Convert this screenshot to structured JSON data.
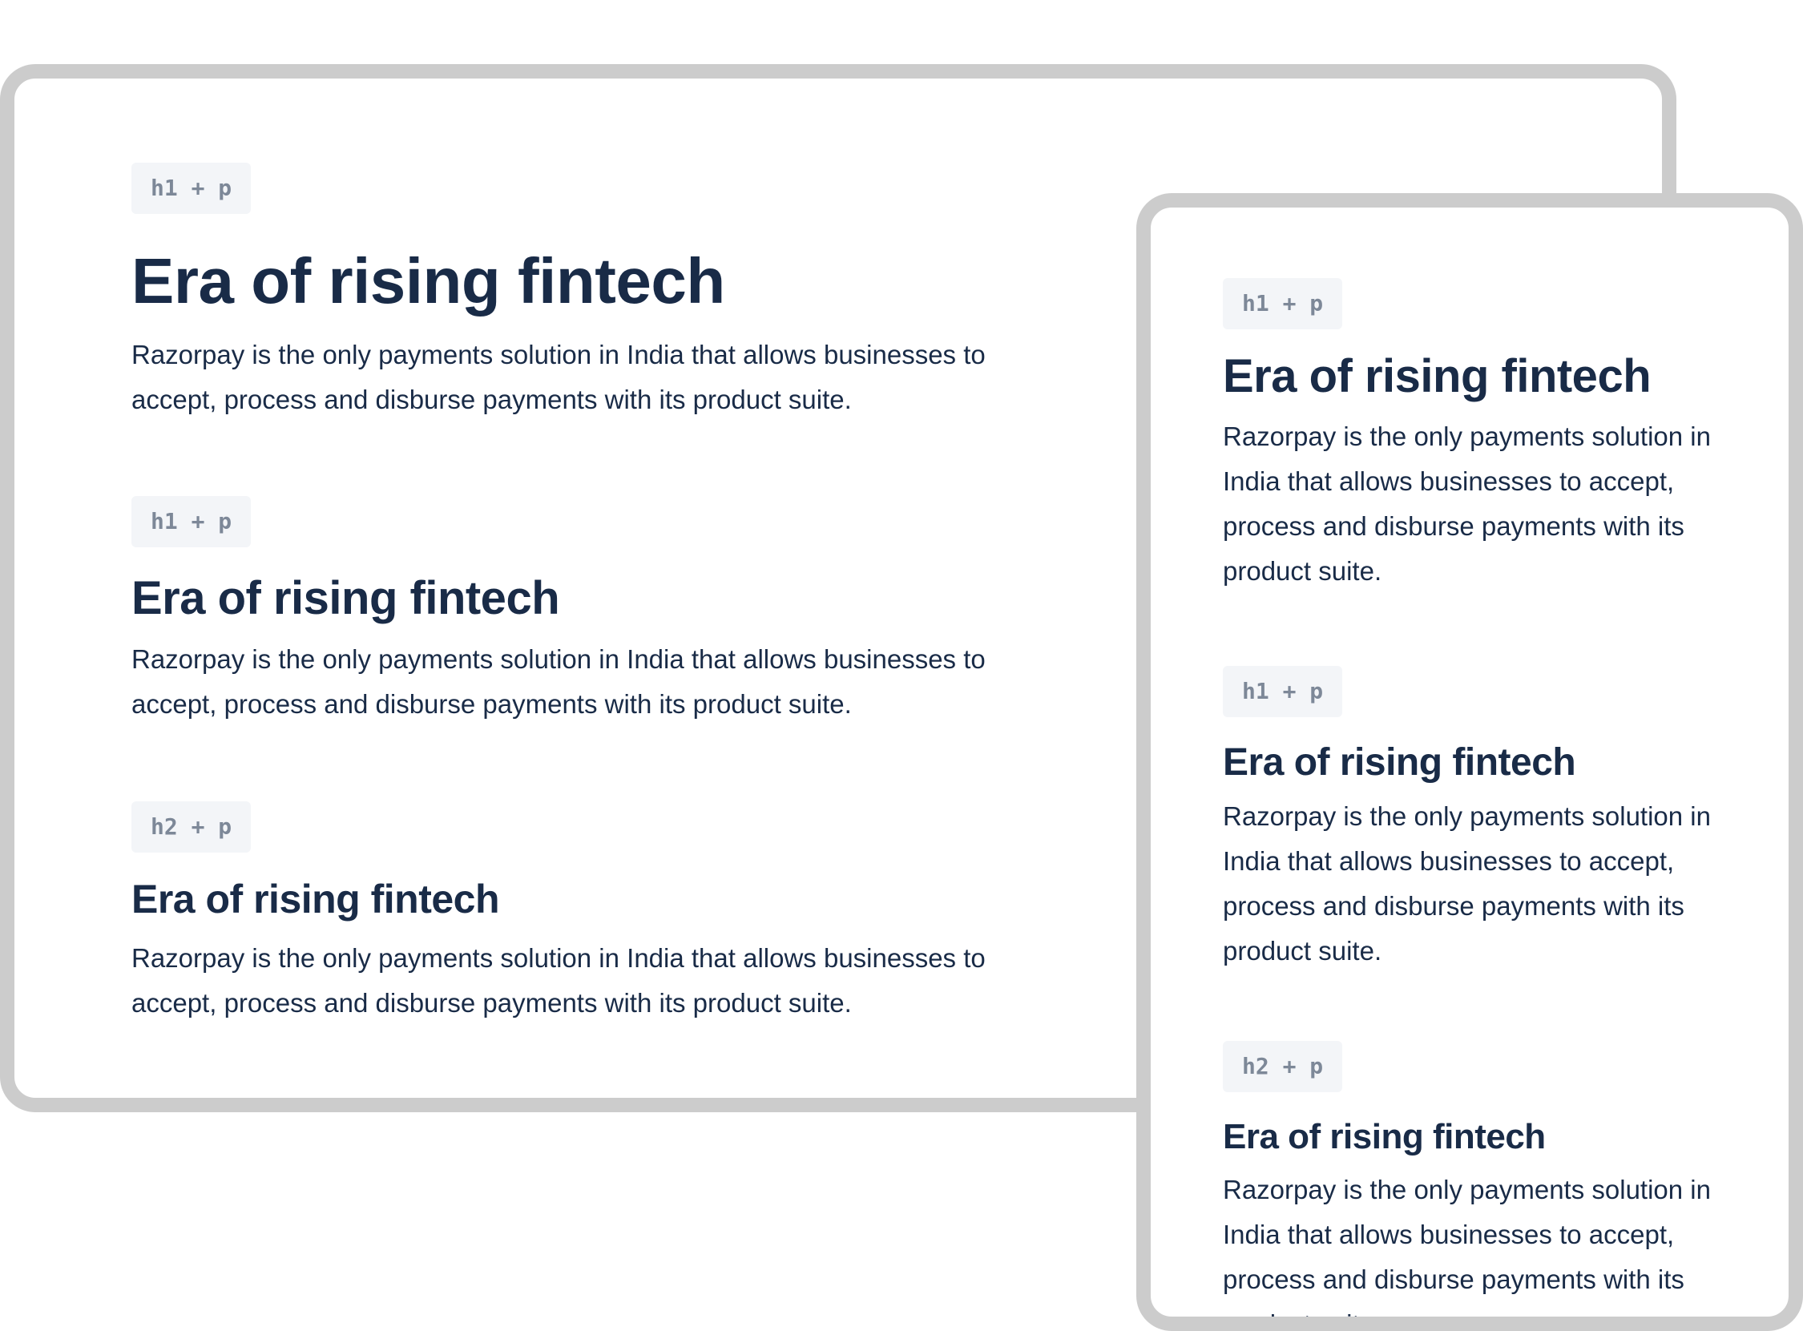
{
  "desktop": {
    "sections": [
      {
        "tag": "h1 + p",
        "heading": "Era of rising fintech",
        "text": "Razorpay is the only payments solution in India that allows businesses to accept, process and disburse payments with its product suite."
      },
      {
        "tag": "h1 + p",
        "heading": "Era of rising fintech",
        "text": "Razorpay is the only payments solution in India that allows businesses to accept, process and disburse payments with its product suite."
      },
      {
        "tag": "h2 + p",
        "heading": "Era of rising fintech",
        "text": "Razorpay is the only payments solution in India that allows businesses to accept, process and disburse payments with its product suite."
      }
    ]
  },
  "mobile": {
    "sections": [
      {
        "tag": "h1 + p",
        "heading": "Era of rising fintech",
        "text": "Razorpay is the only payments solution in India that allows businesses to accept, process and disburse payments with its product suite."
      },
      {
        "tag": "h1 + p",
        "heading": "Era of rising fintech",
        "text": "Razorpay is the only payments solution in India that allows businesses to accept, process and disburse payments with its product suite."
      },
      {
        "tag": "h2 + p",
        "heading": "Era of rising fintech",
        "text": "Razorpay is the only payments solution in India that allows businesses to accept, process and disburse payments with its product suite."
      }
    ]
  },
  "colors": {
    "frame_border": "#cccccc",
    "heading": "#192b47",
    "tag_background": "#f3f5f8",
    "tag_text": "#7d8898"
  }
}
